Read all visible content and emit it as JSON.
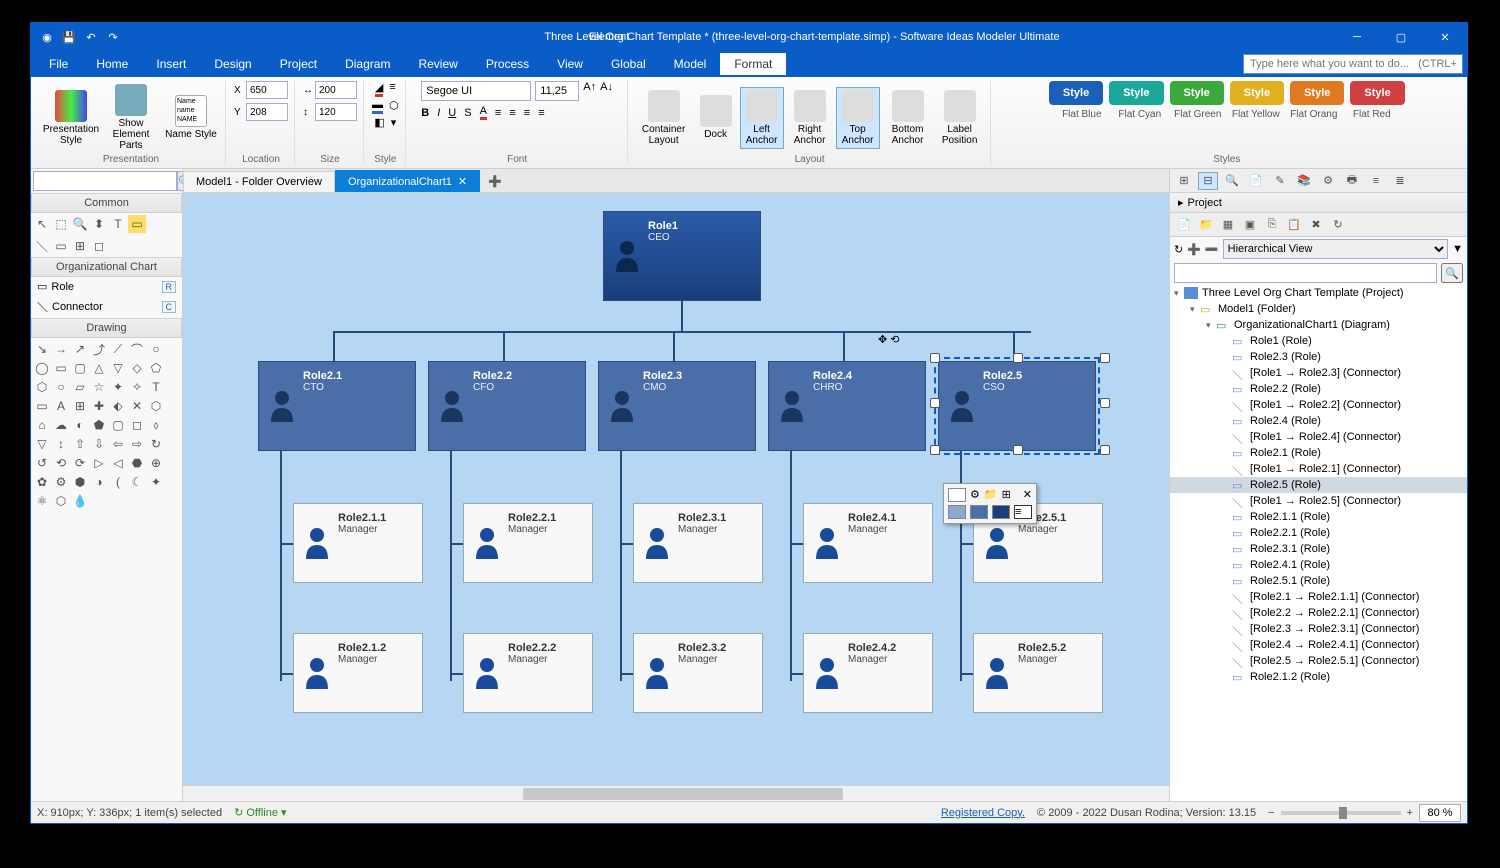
{
  "app": {
    "context_tab": "Element",
    "title": "Three Level Org Chart Template * (three-level-org-chart-template.simp)  - Software Ideas Modeler Ultimate",
    "search_placeholder": "Type here what you want to do...   (CTRL+Q)"
  },
  "menu": [
    "File",
    "Home",
    "Insert",
    "Design",
    "Project",
    "Diagram",
    "Review",
    "Process",
    "View",
    "Global",
    "Model",
    "Format"
  ],
  "menu_active": "Format",
  "ribbon": {
    "presentation": {
      "label": "Presentation",
      "btn1": "Presentation Style",
      "btn2": "Show Element Parts",
      "btn3": "Name Style"
    },
    "location": {
      "label": "Location",
      "x": "650",
      "y": "208"
    },
    "size": {
      "label": "Size",
      "w": "200",
      "h": "120"
    },
    "style": {
      "label": "Style"
    },
    "font": {
      "label": "Font",
      "family": "Segoe UI",
      "size": "11,25"
    },
    "layout": {
      "label": "Layout",
      "container": "Container Layout",
      "dock": "Dock",
      "la": "Left Anchor",
      "ra": "Right Anchor",
      "ta": "Top Anchor",
      "ba": "Bottom Anchor",
      "lp": "Label Position"
    },
    "styles": {
      "label": "Styles",
      "chip": "Style",
      "names": [
        "Flat Blue",
        "Flat Cyan",
        "Flat Green",
        "Flat Yellow",
        "Flat Orang",
        "Flat Red"
      ],
      "colors": [
        "#1a5fb8",
        "#1aa89a",
        "#3aa83a",
        "#e0b020",
        "#e07a20",
        "#d04040"
      ]
    }
  },
  "left": {
    "common": "Common",
    "orgchart": "Organizational Chart",
    "role": "Role",
    "role_key": "R",
    "connector": "Connector",
    "connector_key": "C",
    "drawing": "Drawing"
  },
  "tabs": [
    {
      "label": "Model1 - Folder Overview",
      "active": false
    },
    {
      "label": "OrganizationalChart1",
      "active": true
    }
  ],
  "chart_data": {
    "type": "tree",
    "title": "Three Level Org Chart",
    "root": {
      "role": "Role1",
      "title": "CEO",
      "style": "dark"
    },
    "level2": [
      {
        "role": "Role2.1",
        "title": "CTO",
        "style": "mid"
      },
      {
        "role": "Role2.2",
        "title": "CFO",
        "style": "mid"
      },
      {
        "role": "Role2.3",
        "title": "CMO",
        "style": "mid"
      },
      {
        "role": "Role2.4",
        "title": "CHRO",
        "style": "mid"
      },
      {
        "role": "Role2.5",
        "title": "CSO",
        "style": "mid",
        "selected": true
      }
    ],
    "level3": [
      {
        "role": "Role2.1.1",
        "title": "Manager",
        "style": "light"
      },
      {
        "role": "Role2.2.1",
        "title": "Manager",
        "style": "light"
      },
      {
        "role": "Role2.3.1",
        "title": "Manager",
        "style": "light"
      },
      {
        "role": "Role2.4.1",
        "title": "Manager",
        "style": "light"
      },
      {
        "role": "Role2.5.1",
        "title": "Manager",
        "style": "light"
      },
      {
        "role": "Role2.1.2",
        "title": "Manager",
        "style": "light"
      },
      {
        "role": "Role2.2.2",
        "title": "Manager",
        "style": "light"
      },
      {
        "role": "Role2.3.2",
        "title": "Manager",
        "style": "light"
      },
      {
        "role": "Role2.4.2",
        "title": "Manager",
        "style": "light"
      },
      {
        "role": "Role2.5.2",
        "title": "Manager",
        "style": "light"
      }
    ]
  },
  "project": {
    "header": "Project",
    "view": "Hierarchical View",
    "root": "Three Level Org Chart Template (Project)",
    "items": [
      {
        "t": "Model1 (Folder)",
        "d": 1,
        "ic": "folder"
      },
      {
        "t": "OrganizationalChart1 (Diagram)",
        "d": 2,
        "ic": "diag"
      },
      {
        "t": "Role1 (Role)",
        "d": 3,
        "ic": "role"
      },
      {
        "t": "Role2.3 (Role)",
        "d": 3,
        "ic": "role"
      },
      {
        "t": "[Role1 → Role2.3] (Connector)",
        "d": 3,
        "ic": "conn"
      },
      {
        "t": "Role2.2 (Role)",
        "d": 3,
        "ic": "role"
      },
      {
        "t": "[Role1 → Role2.2] (Connector)",
        "d": 3,
        "ic": "conn"
      },
      {
        "t": "Role2.4 (Role)",
        "d": 3,
        "ic": "role"
      },
      {
        "t": "[Role1 → Role2.4] (Connector)",
        "d": 3,
        "ic": "conn"
      },
      {
        "t": "Role2.1 (Role)",
        "d": 3,
        "ic": "role"
      },
      {
        "t": "[Role1 → Role2.1] (Connector)",
        "d": 3,
        "ic": "conn"
      },
      {
        "t": "Role2.5 (Role)",
        "d": 3,
        "ic": "role",
        "sel": true
      },
      {
        "t": "[Role1 → Role2.5] (Connector)",
        "d": 3,
        "ic": "conn"
      },
      {
        "t": "Role2.1.1 (Role)",
        "d": 3,
        "ic": "role"
      },
      {
        "t": "Role2.2.1 (Role)",
        "d": 3,
        "ic": "role"
      },
      {
        "t": "Role2.3.1 (Role)",
        "d": 3,
        "ic": "role"
      },
      {
        "t": "Role2.4.1 (Role)",
        "d": 3,
        "ic": "role"
      },
      {
        "t": "Role2.5.1 (Role)",
        "d": 3,
        "ic": "role"
      },
      {
        "t": "[Role2.1 → Role2.1.1] (Connector)",
        "d": 3,
        "ic": "conn"
      },
      {
        "t": "[Role2.2 → Role2.2.1] (Connector)",
        "d": 3,
        "ic": "conn"
      },
      {
        "t": "[Role2.3 → Role2.3.1] (Connector)",
        "d": 3,
        "ic": "conn"
      },
      {
        "t": "[Role2.4 → Role2.4.1] (Connector)",
        "d": 3,
        "ic": "conn"
      },
      {
        "t": "[Role2.5 → Role2.5.1] (Connector)",
        "d": 3,
        "ic": "conn"
      },
      {
        "t": "Role2.1.2 (Role)",
        "d": 3,
        "ic": "role"
      }
    ]
  },
  "status": {
    "pos": "X: 910px; Y: 336px; 1 item(s) selected",
    "offline": "Offline",
    "registered": "Registered Copy.",
    "copyright": "© 2009 - 2022 Dusan Rodina; Version: 13.15",
    "zoom": "80 %"
  }
}
